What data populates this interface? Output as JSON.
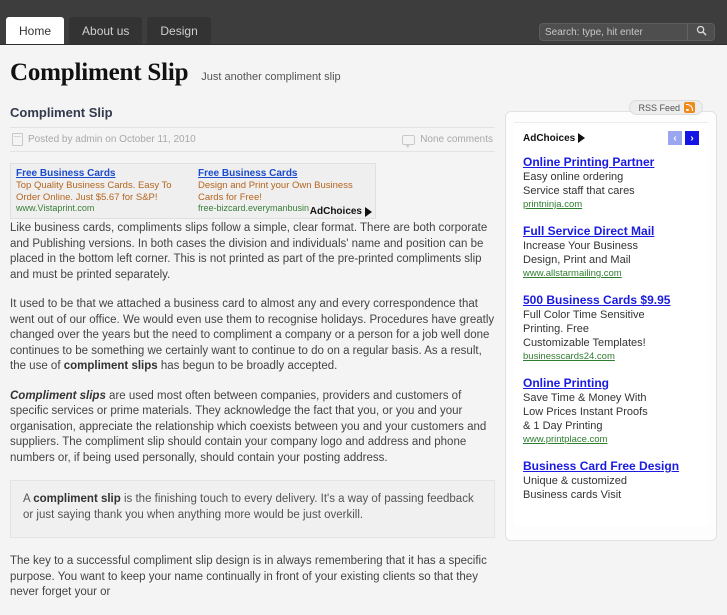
{
  "nav": {
    "tabs": [
      {
        "label": "Home",
        "active": true
      },
      {
        "label": "About us",
        "active": false
      },
      {
        "label": "Design",
        "active": false
      }
    ]
  },
  "search": {
    "placeholder": "Search: type, hit enter",
    "value": "",
    "icon": "search-icon"
  },
  "site": {
    "title": "Compliment Slip",
    "tagline": "Just another compliment slip"
  },
  "post": {
    "title": "Compliment Slip",
    "meta_author": "Posted by admin on October 11, 2010",
    "meta_comments": "None comments",
    "paragraphs": [
      "Like business cards, compliments slips follow a simple, clear format. There are both corporate and Publishing versions. In both cases the division and individuals' name and position can be placed in the bottom left corner. This is not printed as part of the pre-printed compliments slip and must be printed separately.",
      "It used to be that we attached a business card to almost any and every correspondence that went out of our office. We would even use them to recognise holidays. Procedures have greatly changed over the years but the need to compliment a company or a person for a job well done continues to be something we certainly want to continue to do on a regular basis. As a result, the use of compliment slips has begun to be broadly accepted.",
      "Compliment slips are used most often between companies, providers and customers of specific services or prime materials. They acknowledge the fact that you, or you and your organisation, appreciate the relationship which coexists between you and your customers and suppliers. The compliment slip should contain your company logo and address and phone numbers or, if being used personally, should contain your posting address."
    ],
    "quote": "A compliment slip is the finishing touch to every delivery. It's a way of passing feedback or just saying thank you when anything more would be just overkill.",
    "last_paragraph": "The key to a successful compliment slip design is in always remembering that it has a specific purpose. You want to keep your name continually in front of your existing clients so that they never forget your or"
  },
  "inline_ad": {
    "adchoices_label": "AdChoices",
    "items": [
      {
        "title": "Free Business Cards",
        "body": "Top Quality Business Cards. Easy To Order Online. Just $5.67 for S&P!",
        "url": "www.Vistaprint.com"
      },
      {
        "title": "Free Business Cards",
        "body": "Design and Print your Own Business Cards for Free!",
        "url": "free-bizcard.everymanbusiness.com"
      }
    ]
  },
  "sidebar": {
    "rss_label": "RSS Feed",
    "adchoices_label": "AdChoices",
    "prev_arrow": "‹",
    "next_arrow": "›",
    "ads": [
      {
        "title": "Online Printing Partner",
        "lines": [
          "Easy online ordering",
          "Service staff that cares"
        ],
        "url": "printninja.com"
      },
      {
        "title": "Full Service Direct Mail",
        "lines": [
          "Increase Your Business",
          "Design, Print and Mail"
        ],
        "url": "www.allstarmailing.com"
      },
      {
        "title": "500 Business Cards $9.95",
        "lines": [
          "Full Color Time Sensitive",
          "Printing. Free",
          "Customizable Templates!"
        ],
        "url": "businesscards24.com"
      },
      {
        "title": "Online Printing",
        "lines": [
          "Save Time & Money With",
          "Low Prices Instant Proofs",
          "& 1 Day Printing"
        ],
        "url": "www.printplace.com"
      },
      {
        "title": "Business Card Free Design",
        "lines": [
          "Unique & customized",
          "Business cards Visit"
        ],
        "url": ""
      }
    ]
  }
}
